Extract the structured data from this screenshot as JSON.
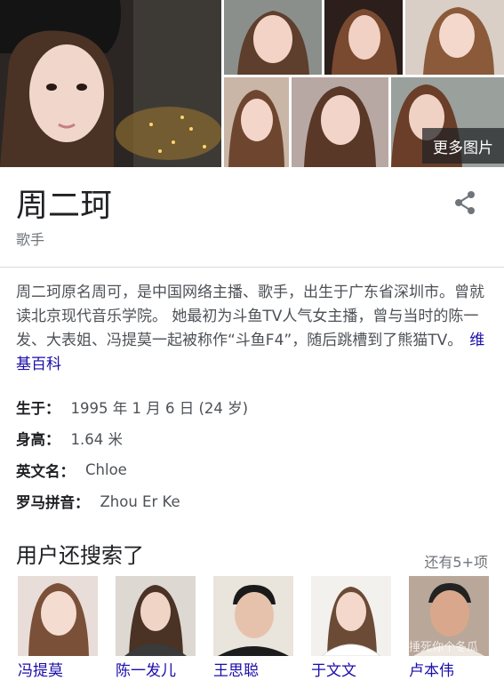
{
  "gallery": {
    "more_images_label": "更多图片"
  },
  "panel": {
    "title": "周二珂",
    "subtitle": "歌手",
    "description": "周二珂原名周可，是中国网络主播、歌手，出生于广东省深圳市。曾就读北京现代音乐学院。 她最初为斗鱼TV人气女主播，曾与当时的陈一发、大表姐、冯提莫一起被称作“斗鱼F4”，随后跳槽到了熊猫TV。",
    "source_link": "维基百科"
  },
  "facts": [
    {
      "key": "生于：",
      "value": "1995 年 1 月 6 日 (24 岁)"
    },
    {
      "key": "身高：",
      "value": "1.64 米"
    },
    {
      "key": "英文名：",
      "value": "Chloe"
    },
    {
      "key": "罗马拼音：",
      "value": "Zhou Er Ke"
    }
  ],
  "people_also_search": {
    "heading": "用户还搜索了",
    "more_label": "还有5+项",
    "items": [
      {
        "name": "冯提莫"
      },
      {
        "name": "陈一发儿"
      },
      {
        "name": "王思聪"
      },
      {
        "name": "于文文"
      },
      {
        "name": "卢本伟",
        "watermark": "捶死你个冬瓜"
      }
    ]
  },
  "colors": {
    "link": "#1a0dab",
    "text": "#202124",
    "muted": "#70757a",
    "divider": "#dadce0"
  }
}
